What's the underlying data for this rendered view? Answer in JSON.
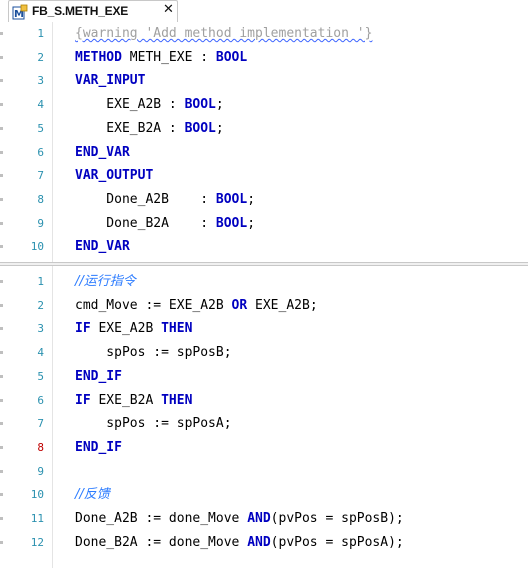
{
  "tab": {
    "title": "FB_S.METH_EXE",
    "close_glyph": "✕",
    "icon": "method-icon"
  },
  "colors": {
    "keyword": "#0000c0",
    "line_number": "#2b91af",
    "line_number_error": "#c00000",
    "comment": "#2b7bff",
    "warning_comment": "#a0a0a0",
    "wavy_underline": "#3b63ff"
  },
  "declaration": {
    "lines": [
      {
        "n": "1",
        "parts": [
          [
            "cmt-wavy",
            "{warning 'Add method implementation '}"
          ]
        ]
      },
      {
        "n": "2",
        "parts": [
          [
            "kw",
            "METHOD"
          ],
          [
            "id",
            " METH_EXE : "
          ],
          [
            "kw",
            "BOOL"
          ]
        ]
      },
      {
        "n": "3",
        "parts": [
          [
            "kw",
            "VAR_INPUT"
          ]
        ]
      },
      {
        "n": "4",
        "parts": [
          [
            "id",
            "    EXE_A2B : "
          ],
          [
            "kw",
            "BOOL"
          ],
          [
            "id",
            ";"
          ]
        ]
      },
      {
        "n": "5",
        "parts": [
          [
            "id",
            "    EXE_B2A : "
          ],
          [
            "kw",
            "BOOL"
          ],
          [
            "id",
            ";"
          ]
        ]
      },
      {
        "n": "6",
        "parts": [
          [
            "kw",
            "END_VAR"
          ]
        ]
      },
      {
        "n": "7",
        "parts": [
          [
            "kw",
            "VAR_OUTPUT"
          ]
        ]
      },
      {
        "n": "8",
        "parts": [
          [
            "id",
            "    Done_A2B    : "
          ],
          [
            "kw",
            "BOOL"
          ],
          [
            "id",
            ";"
          ]
        ]
      },
      {
        "n": "9",
        "parts": [
          [
            "id",
            "    Done_B2A    : "
          ],
          [
            "kw",
            "BOOL"
          ],
          [
            "id",
            ";"
          ]
        ]
      },
      {
        "n": "10",
        "parts": [
          [
            "kw",
            "END_VAR"
          ]
        ]
      }
    ]
  },
  "implementation": {
    "lines": [
      {
        "n": "1",
        "parts": [
          [
            "cmtz",
            "//运行指令"
          ]
        ]
      },
      {
        "n": "2",
        "parts": [
          [
            "id",
            "cmd_Move := EXE_A2B "
          ],
          [
            "kw",
            "OR"
          ],
          [
            "id",
            " EXE_A2B;"
          ]
        ]
      },
      {
        "n": "3",
        "parts": [
          [
            "kw",
            "IF"
          ],
          [
            "id",
            " EXE_A2B "
          ],
          [
            "kw",
            "THEN"
          ]
        ]
      },
      {
        "n": "4",
        "parts": [
          [
            "id",
            "    spPos := spPosB;"
          ]
        ]
      },
      {
        "n": "5",
        "parts": [
          [
            "kw",
            "END_IF"
          ]
        ]
      },
      {
        "n": "6",
        "parts": [
          [
            "kw",
            "IF"
          ],
          [
            "id",
            " EXE_B2A "
          ],
          [
            "kw",
            "THEN"
          ]
        ]
      },
      {
        "n": "7",
        "parts": [
          [
            "id",
            "    spPos := spPosA;"
          ]
        ]
      },
      {
        "n": "8",
        "error": true,
        "parts": [
          [
            "kw",
            "END_IF"
          ]
        ]
      },
      {
        "n": "9",
        "parts": []
      },
      {
        "n": "10",
        "parts": [
          [
            "cmtz",
            "//反馈"
          ]
        ]
      },
      {
        "n": "11",
        "parts": [
          [
            "id",
            "Done_A2B := done_Move "
          ],
          [
            "kw",
            "AND"
          ],
          [
            "id",
            "(pvPos = spPosB);"
          ]
        ]
      },
      {
        "n": "12",
        "parts": [
          [
            "id",
            "Done_B2A := done_Move "
          ],
          [
            "kw",
            "AND"
          ],
          [
            "id",
            "(pvPos = spPosA);"
          ]
        ]
      }
    ]
  }
}
